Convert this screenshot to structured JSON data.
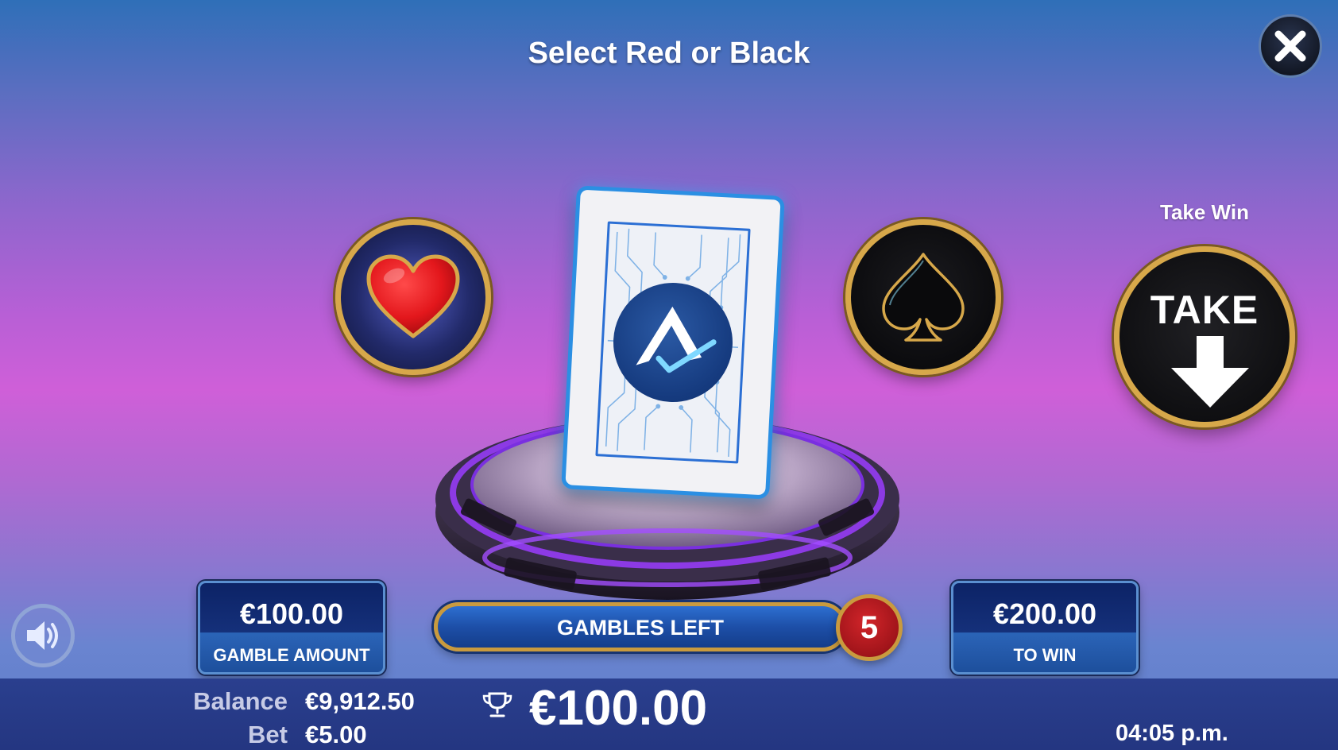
{
  "header": {
    "title": "Select Red or Black"
  },
  "icons": {
    "close": "close-icon",
    "heart": "heart-icon",
    "spade": "spade-icon",
    "take_arrow": "arrow-down-icon",
    "sound": "speaker-icon",
    "trophy": "trophy-icon",
    "card_logo": "logo-icon"
  },
  "colors": {
    "accent_gold": "#d7a84a",
    "heart_red": "#e3171c",
    "card_border": "#2b8fe3",
    "badge_red": "#c41e24"
  },
  "take_win": {
    "label": "Take Win",
    "button_text": "TAKE"
  },
  "gamble_amount": {
    "value": "€100.00",
    "caption": "GAMBLE AMOUNT"
  },
  "gambles_left": {
    "label": "GAMBLES LEFT",
    "count": "5"
  },
  "to_win": {
    "value": "€200.00",
    "caption": "TO WIN"
  },
  "footer": {
    "balance_label": "Balance",
    "balance_value": "€9,912.50",
    "bet_label": "Bet",
    "bet_value": "€5.00",
    "win_amount": "€100.00",
    "time": "04:05 p.m."
  }
}
